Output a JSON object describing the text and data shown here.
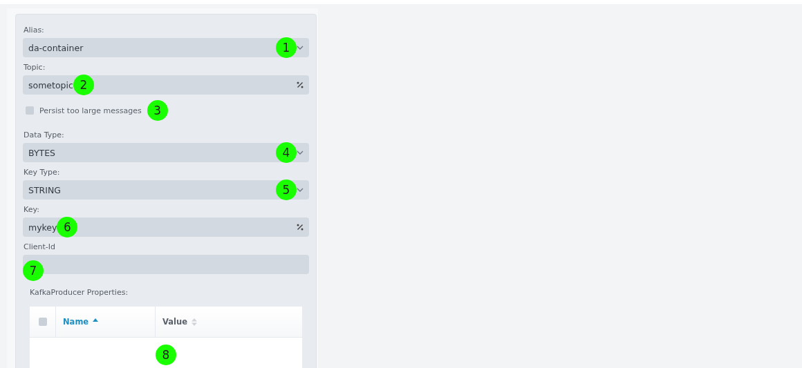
{
  "fields": [
    {
      "kind": "select",
      "label": "Alias:",
      "value": "da-container",
      "marker": "1"
    },
    {
      "kind": "text",
      "label": "Topic:",
      "value": "sometopic",
      "marker": "2"
    },
    {
      "kind": "checkbox",
      "label": "Persist too large messages",
      "checked": false,
      "marker": "3"
    },
    {
      "kind": "select",
      "label": "Data Type:",
      "value": "BYTES",
      "marker": "4"
    },
    {
      "kind": "select",
      "label": "Key Type:",
      "value": "STRING",
      "marker": "5"
    },
    {
      "kind": "text",
      "label": "Key:",
      "value": "mykey",
      "marker": "6"
    },
    {
      "kind": "plain",
      "label": "Client-Id",
      "marker": "7"
    }
  ],
  "properties": {
    "title": "KafkaProducer Properties:",
    "all_checked": false,
    "columns": [
      {
        "label": "Name",
        "sorted": true
      },
      {
        "label": "Value",
        "sorted": false
      }
    ],
    "marker": "8"
  }
}
